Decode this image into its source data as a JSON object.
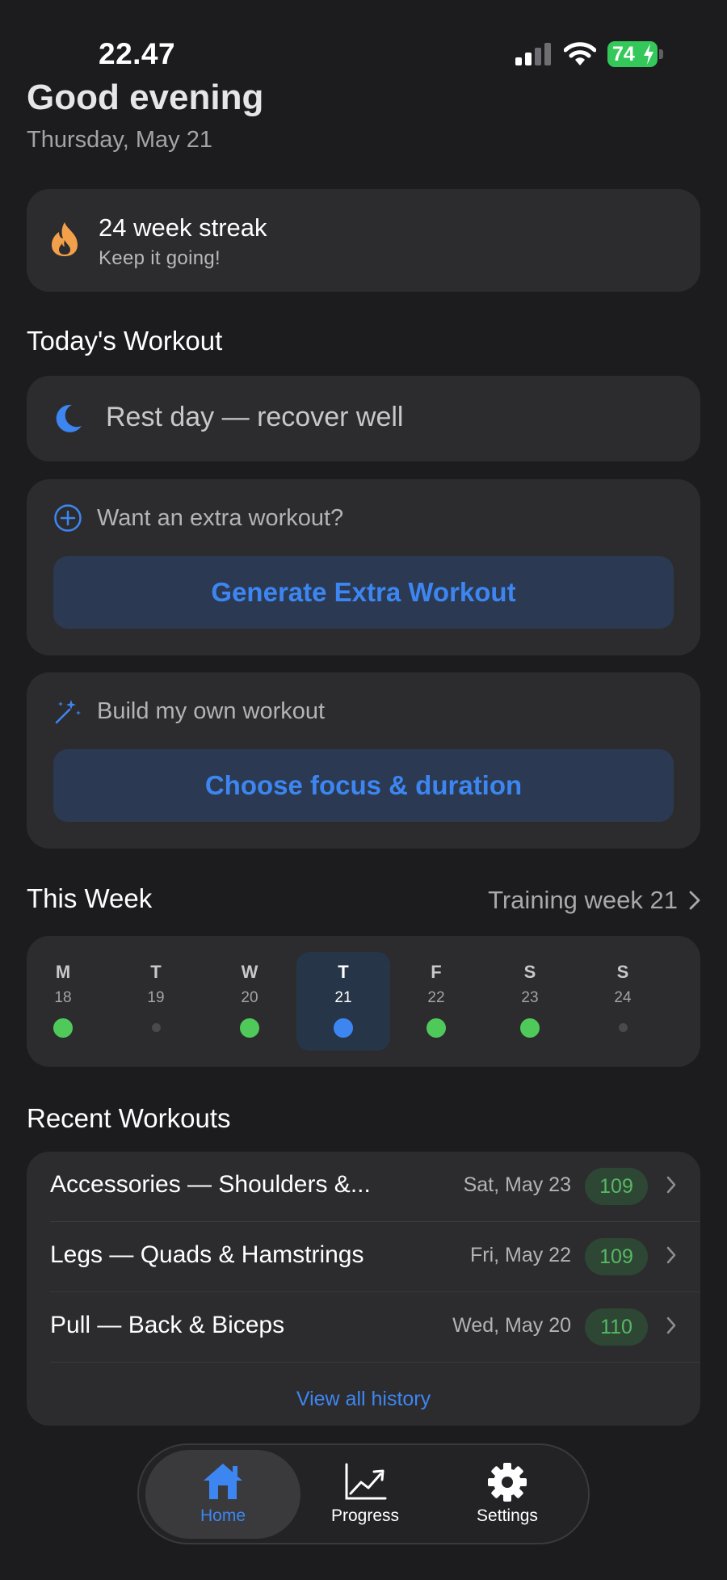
{
  "status_bar": {
    "time": "22.47",
    "battery": "74"
  },
  "header": {
    "greeting": "Good evening",
    "date": "Thursday, May 21"
  },
  "streak": {
    "title": "24 week streak",
    "subtitle": "Keep it going!",
    "icon": "fire-icon"
  },
  "todays_workout": {
    "section_title": "Today's Workout",
    "rest_label": "Rest day — recover well",
    "rest_icon": "moon-icon"
  },
  "extra_workout": {
    "prompt": "Want an extra workout?",
    "button": "Generate Extra Workout",
    "icon": "plus-circle-icon"
  },
  "build_workout": {
    "prompt": "Build my own workout",
    "button": "Choose focus & duration",
    "icon": "magic-wand-icon"
  },
  "this_week": {
    "section_title": "This Week",
    "link_label": "Training week 21",
    "days": [
      {
        "letter": "M",
        "num": "18",
        "status": "done"
      },
      {
        "letter": "T",
        "num": "19",
        "status": "empty"
      },
      {
        "letter": "W",
        "num": "20",
        "status": "done"
      },
      {
        "letter": "T",
        "num": "21",
        "status": "today"
      },
      {
        "letter": "F",
        "num": "22",
        "status": "done"
      },
      {
        "letter": "S",
        "num": "23",
        "status": "done"
      },
      {
        "letter": "S",
        "num": "24",
        "status": "empty"
      }
    ]
  },
  "recent": {
    "section_title": "Recent Workouts",
    "items": [
      {
        "name": "Accessories — Shoulders &...",
        "date": "Sat, May 23",
        "score": "109"
      },
      {
        "name": "Legs — Quads & Hamstrings",
        "date": "Fri, May 22",
        "score": "109"
      },
      {
        "name": "Pull — Back & Biceps",
        "date": "Wed, May 20",
        "score": "110"
      }
    ],
    "view_all": "View all history"
  },
  "tabbar": {
    "tabs": [
      {
        "label": "Home",
        "icon": "home-icon",
        "active": true
      },
      {
        "label": "Progress",
        "icon": "chart-icon",
        "active": false
      },
      {
        "label": "Settings",
        "icon": "gear-icon",
        "active": false
      }
    ]
  },
  "colors": {
    "background": "#1c1c1e",
    "card": "#2c2c2e",
    "accent": "#3d86f2",
    "success": "#4fc95a",
    "streak": "#f4a04a",
    "button_bg": "#2b3a52"
  }
}
